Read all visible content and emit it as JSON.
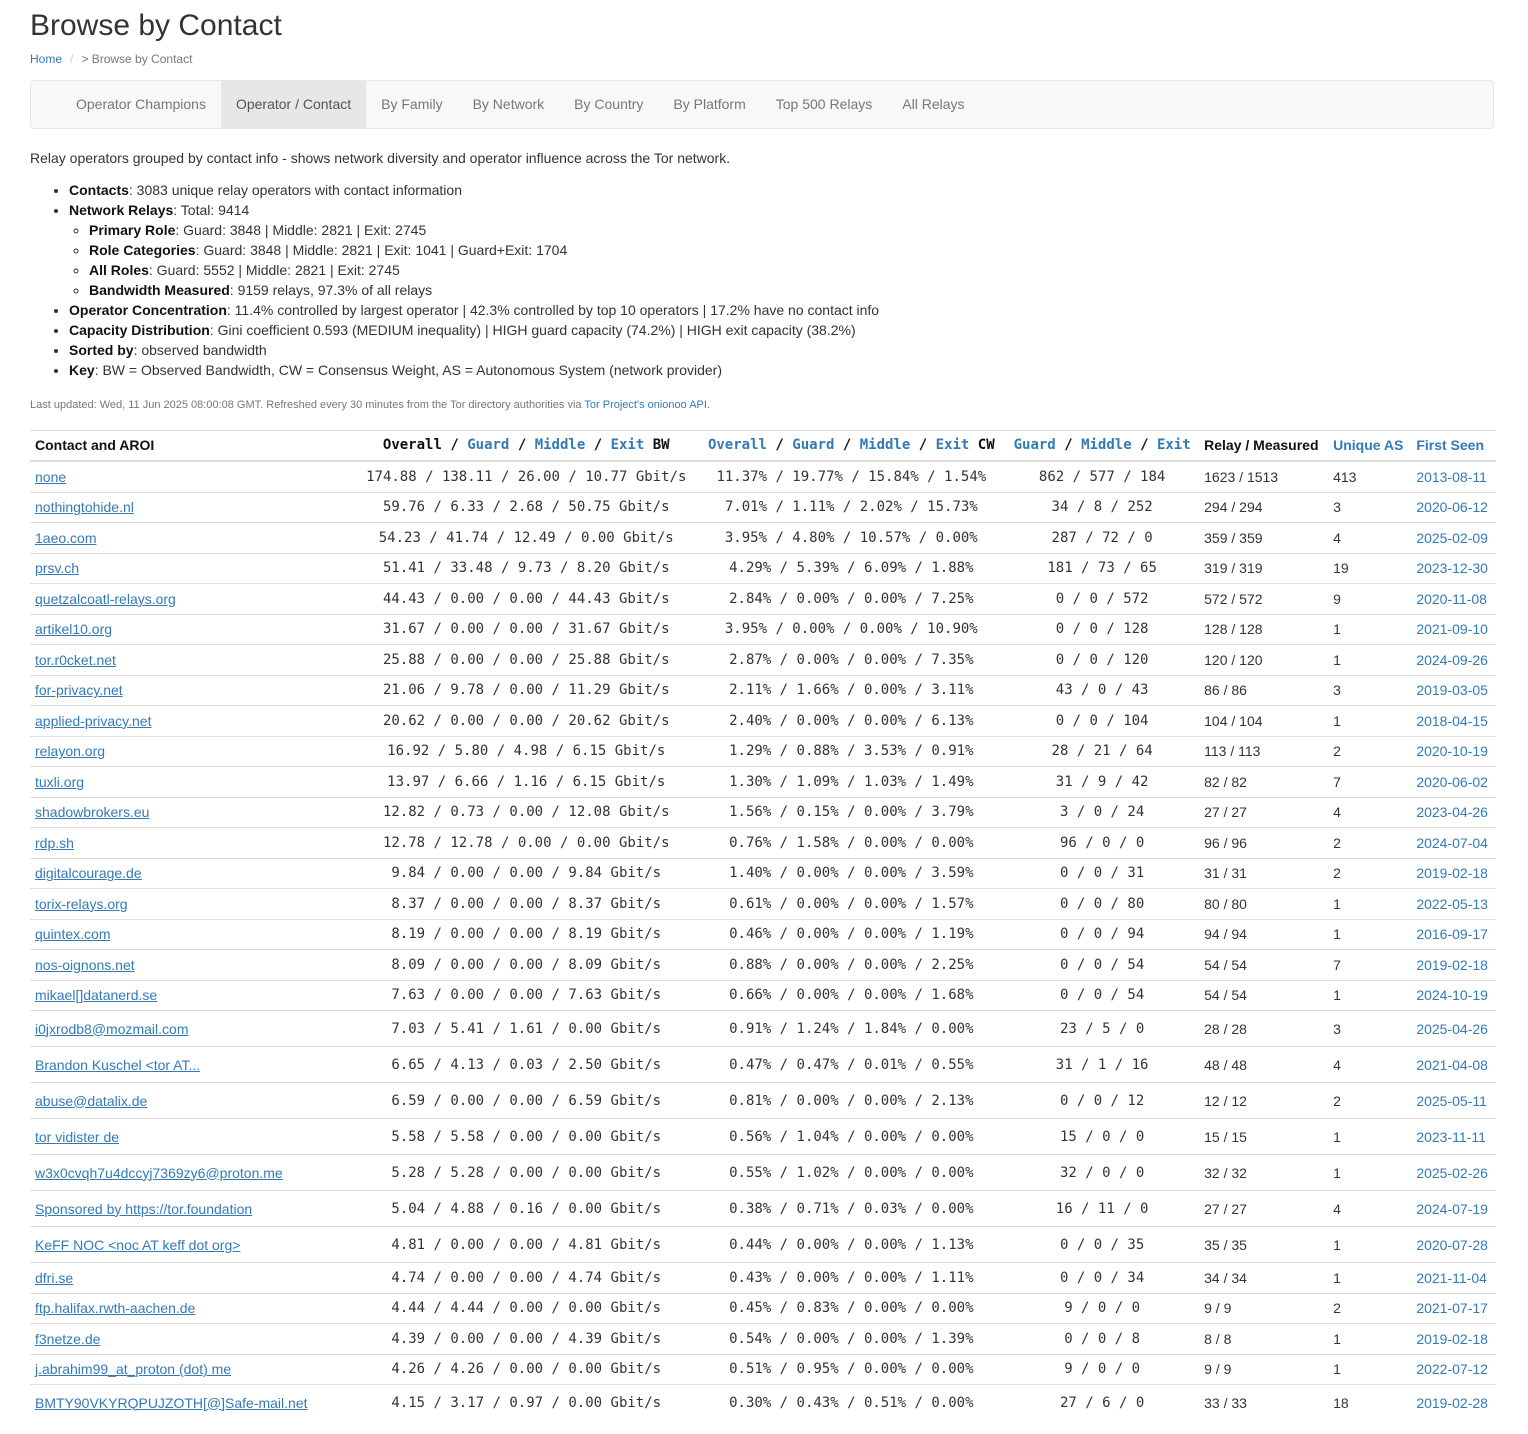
{
  "page": {
    "title": "Browse by Contact",
    "breadcrumb": {
      "home": "Home",
      "sep": "/",
      "current": "> Browse by Contact"
    }
  },
  "nav": {
    "tabs": [
      {
        "label": "Operator Champions"
      },
      {
        "label": "Operator / Contact"
      },
      {
        "label": "By Family"
      },
      {
        "label": "By Network"
      },
      {
        "label": "By Country"
      },
      {
        "label": "By Platform"
      },
      {
        "label": "Top 500 Relays"
      },
      {
        "label": "All Relays"
      }
    ]
  },
  "intro": "Relay operators grouped by contact info - shows network diversity and operator influence across the Tor network.",
  "summary": {
    "contacts": {
      "label": "Contacts",
      "text": ": 3083 unique relay operators with contact information"
    },
    "network_relays": {
      "label": "Network Relays",
      "text": ": Total: 9414"
    },
    "primary_role": {
      "label": "Primary Role",
      "text": ": Guard: 3848 | Middle: 2821 | Exit: 2745"
    },
    "role_categories": {
      "label": "Role Categories",
      "text": ": Guard: 3848 | Middle: 2821 | Exit: 1041 | Guard+Exit: 1704"
    },
    "all_roles": {
      "label": "All Roles",
      "text": ": Guard: 5552 | Middle: 2821 | Exit: 2745"
    },
    "bandwidth_measured": {
      "label": "Bandwidth Measured",
      "text": ": 9159 relays, 97.3% of all relays"
    },
    "operator_concentration": {
      "label": "Operator Concentration",
      "text": ": 11.4% controlled by largest operator | 42.3% controlled by top 10 operators | 17.2% have no contact info"
    },
    "capacity_distribution": {
      "label": "Capacity Distribution",
      "text": ": Gini coefficient 0.593 (MEDIUM inequality) | HIGH guard capacity (74.2%) | HIGH exit capacity (38.2%)"
    },
    "sorted_by": {
      "label": "Sorted by",
      "text": ": observed bandwidth"
    },
    "key": {
      "label": "Key",
      "text": ": BW = Observed Bandwidth, CW = Consensus Weight, AS = Autonomous System (network provider)"
    }
  },
  "updated": {
    "prefix": "Last updated: Wed, 11 Jun 2025 08:00:08 GMT. Refreshed every 30 minutes from the Tor directory authorities via ",
    "link": "Tor Project's onionoo API",
    "suffix": "."
  },
  "table": {
    "headers": {
      "contact": "Contact and AROI",
      "bw_overall": "Overall",
      "bw_guard": "Guard",
      "bw_middle": "Middle",
      "bw_exit": "Exit",
      "bw_suffix": "BW",
      "cw_overall": "Overall",
      "cw_guard": "Guard",
      "cw_middle": "Middle",
      "cw_exit": "Exit",
      "cw_suffix": "CW",
      "cnt_guard": "Guard",
      "cnt_middle": "Middle",
      "cnt_exit": "Exit",
      "relay_measured": "Relay / Measured",
      "unique_as": "Unique AS",
      "first_seen": "First Seen",
      "slash": "/"
    },
    "rows": [
      {
        "contact": "none",
        "bw": "174.88 / 138.11 / 26.00 / 10.77 Gbit/s",
        "cw": "11.37% / 19.77% / 15.84% / 1.54%",
        "counts": "862 / 577 / 184",
        "relays": "1623 / 1513",
        "as": "413",
        "seen": "2013-08-11"
      },
      {
        "contact": "nothingtohide.nl",
        "bw": "59.76 / 6.33 / 2.68 / 50.75 Gbit/s",
        "cw": "7.01% / 1.11% / 2.02% / 15.73%",
        "counts": "34 / 8 / 252",
        "relays": "294 / 294",
        "as": "3",
        "seen": "2020-06-12"
      },
      {
        "contact": "1aeo.com",
        "bw": "54.23 / 41.74 / 12.49 / 0.00 Gbit/s",
        "cw": "3.95% / 4.80% / 10.57% / 0.00%",
        "counts": "287 / 72 / 0",
        "relays": "359 / 359",
        "as": "4",
        "seen": "2025-02-09"
      },
      {
        "contact": "prsv.ch",
        "bw": "51.41 / 33.48 / 9.73 / 8.20 Gbit/s",
        "cw": "4.29% / 5.39% / 6.09% / 1.88%",
        "counts": "181 / 73 / 65",
        "relays": "319 / 319",
        "as": "19",
        "seen": "2023-12-30"
      },
      {
        "contact": "quetzalcoatl-relays.org",
        "bw": "44.43 / 0.00 / 0.00 / 44.43 Gbit/s",
        "cw": "2.84% / 0.00% / 0.00% / 7.25%",
        "counts": "0 / 0 / 572",
        "relays": "572 / 572",
        "as": "9",
        "seen": "2020-11-08"
      },
      {
        "contact": "artikel10.org",
        "bw": "31.67 / 0.00 / 0.00 / 31.67 Gbit/s",
        "cw": "3.95% / 0.00% / 0.00% / 10.90%",
        "counts": "0 / 0 / 128",
        "relays": "128 / 128",
        "as": "1",
        "seen": "2021-09-10"
      },
      {
        "contact": "tor.r0cket.net",
        "bw": "25.88 / 0.00 / 0.00 / 25.88 Gbit/s",
        "cw": "2.87% / 0.00% / 0.00% / 7.35%",
        "counts": "0 / 0 / 120",
        "relays": "120 / 120",
        "as": "1",
        "seen": "2024-09-26"
      },
      {
        "contact": "for-privacy.net",
        "bw": "21.06 / 9.78 / 0.00 / 11.29 Gbit/s",
        "cw": "2.11% / 1.66% / 0.00% / 3.11%",
        "counts": "43 / 0 / 43",
        "relays": "86 / 86",
        "as": "3",
        "seen": "2019-03-05"
      },
      {
        "contact": "applied-privacy.net",
        "bw": "20.62 / 0.00 / 0.00 / 20.62 Gbit/s",
        "cw": "2.40% / 0.00% / 0.00% / 6.13%",
        "counts": "0 / 0 / 104",
        "relays": "104 / 104",
        "as": "1",
        "seen": "2018-04-15"
      },
      {
        "contact": "relayon.org",
        "bw": "16.92 / 5.80 / 4.98 / 6.15 Gbit/s",
        "cw": "1.29% / 0.88% / 3.53% / 0.91%",
        "counts": "28 / 21 / 64",
        "relays": "113 / 113",
        "as": "2",
        "seen": "2020-10-19"
      },
      {
        "contact": "tuxli.org",
        "bw": "13.97 / 6.66 / 1.16 / 6.15 Gbit/s",
        "cw": "1.30% / 1.09% / 1.03% / 1.49%",
        "counts": "31 / 9 / 42",
        "relays": "82 / 82",
        "as": "7",
        "seen": "2020-06-02"
      },
      {
        "contact": "shadowbrokers.eu",
        "bw": "12.82 / 0.73 / 0.00 / 12.08 Gbit/s",
        "cw": "1.56% / 0.15% / 0.00% / 3.79%",
        "counts": "3 / 0 / 24",
        "relays": "27 / 27",
        "as": "4",
        "seen": "2023-04-26"
      },
      {
        "contact": "rdp.sh",
        "bw": "12.78 / 12.78 / 0.00 / 0.00 Gbit/s",
        "cw": "0.76% / 1.58% / 0.00% / 0.00%",
        "counts": "96 / 0 / 0",
        "relays": "96 / 96",
        "as": "2",
        "seen": "2024-07-04"
      },
      {
        "contact": "digitalcourage.de",
        "bw": "9.84 / 0.00 / 0.00 / 9.84 Gbit/s",
        "cw": "1.40% / 0.00% / 0.00% / 3.59%",
        "counts": "0 / 0 / 31",
        "relays": "31 / 31",
        "as": "2",
        "seen": "2019-02-18"
      },
      {
        "contact": "torix-relays.org",
        "bw": "8.37 / 0.00 / 0.00 / 8.37 Gbit/s",
        "cw": "0.61% / 0.00% / 0.00% / 1.57%",
        "counts": "0 / 0 / 80",
        "relays": "80 / 80",
        "as": "1",
        "seen": "2022-05-13"
      },
      {
        "contact": "quintex.com",
        "bw": "8.19 / 0.00 / 0.00 / 8.19 Gbit/s",
        "cw": "0.46% / 0.00% / 0.00% / 1.19%",
        "counts": "0 / 0 / 94",
        "relays": "94 / 94",
        "as": "1",
        "seen": "2016-09-17"
      },
      {
        "contact": "nos-oignons.net",
        "bw": "8.09 / 0.00 / 0.00 / 8.09 Gbit/s",
        "cw": "0.88% / 0.00% / 0.00% / 2.25%",
        "counts": "0 / 0 / 54",
        "relays": "54 / 54",
        "as": "7",
        "seen": "2019-02-18"
      },
      {
        "contact": "mikael[]datanerd.se",
        "bw": "7.63 / 0.00 / 0.00 / 7.63 Gbit/s",
        "cw": "0.66% / 0.00% / 0.00% / 1.68%",
        "counts": "0 / 0 / 54",
        "relays": "54 / 54",
        "as": "1",
        "seen": "2024-10-19"
      },
      {
        "contact": "i0jxrodb8@mozmail.com",
        "bw": "7.03 / 5.41 / 1.61 / 0.00 Gbit/s",
        "cw": "0.91% / 1.24% / 1.84% / 0.00%",
        "counts": "23 / 5 / 0",
        "relays": "28 / 28",
        "as": "3",
        "seen": "2025-04-26",
        "tall": true
      },
      {
        "contact": "Brandon Kuschel <tor AT...",
        "bw": "6.65 / 4.13 / 0.03 / 2.50 Gbit/s",
        "cw": "0.47% / 0.47% / 0.01% / 0.55%",
        "counts": "31 / 1 / 16",
        "relays": "48 / 48",
        "as": "4",
        "seen": "2021-04-08",
        "tall": true
      },
      {
        "contact": "abuse@datalix.de",
        "bw": "6.59 / 0.00 / 0.00 / 6.59 Gbit/s",
        "cw": "0.81% / 0.00% / 0.00% / 2.13%",
        "counts": "0 / 0 / 12",
        "relays": "12 / 12",
        "as": "2",
        "seen": "2025-05-11",
        "tall": true
      },
      {
        "contact": "tor vidister de",
        "bw": "5.58 / 5.58 / 0.00 / 0.00 Gbit/s",
        "cw": "0.56% / 1.04% / 0.00% / 0.00%",
        "counts": "15 / 0 / 0",
        "relays": "15 / 15",
        "as": "1",
        "seen": "2023-11-11",
        "tall": true
      },
      {
        "contact": "w3x0cvqh7u4dccyj7369zy6@proton.me",
        "bw": "5.28 / 5.28 / 0.00 / 0.00 Gbit/s",
        "cw": "0.55% / 1.02% / 0.00% / 0.00%",
        "counts": "32 / 0 / 0",
        "relays": "32 / 32",
        "as": "1",
        "seen": "2025-02-26",
        "tall": true
      },
      {
        "contact": "Sponsored by https://tor.foundation",
        "bw": "5.04 / 4.88 / 0.16 / 0.00 Gbit/s",
        "cw": "0.38% / 0.71% / 0.03% / 0.00%",
        "counts": "16 / 11 / 0",
        "relays": "27 / 27",
        "as": "4",
        "seen": "2024-07-19",
        "tall": true
      },
      {
        "contact": "KeFF NOC <noc AT keff dot org>",
        "bw": "4.81 / 0.00 / 0.00 / 4.81 Gbit/s",
        "cw": "0.44% / 0.00% / 0.00% / 1.13%",
        "counts": "0 / 0 / 35",
        "relays": "35 / 35",
        "as": "1",
        "seen": "2020-07-28",
        "tall": true
      },
      {
        "contact": "dfri.se",
        "bw": "4.74 / 0.00 / 0.00 / 4.74 Gbit/s",
        "cw": "0.43% / 0.00% / 0.00% / 1.11%",
        "counts": "0 / 0 / 34",
        "relays": "34 / 34",
        "as": "1",
        "seen": "2021-11-04"
      },
      {
        "contact": "ftp.halifax.rwth-aachen.de",
        "bw": "4.44 / 4.44 / 0.00 / 0.00 Gbit/s",
        "cw": "0.45% / 0.83% / 0.00% / 0.00%",
        "counts": "9 / 0 / 0",
        "relays": "9 / 9",
        "as": "2",
        "seen": "2021-07-17"
      },
      {
        "contact": "f3netze.de",
        "bw": "4.39 / 0.00 / 0.00 / 4.39 Gbit/s",
        "cw": "0.54% / 0.00% / 0.00% / 1.39%",
        "counts": "0 / 0 / 8",
        "relays": "8 / 8",
        "as": "1",
        "seen": "2019-02-18"
      },
      {
        "contact": "j.abrahim99_at_proton (dot) me",
        "bw": "4.26 / 4.26 / 0.00 / 0.00 Gbit/s",
        "cw": "0.51% / 0.95% / 0.00% / 0.00%",
        "counts": "9 / 0 / 0",
        "relays": "9 / 9",
        "as": "1",
        "seen": "2022-07-12"
      },
      {
        "contact": "BMTY90VKYRQPUJZOTH[@]Safe-mail.net",
        "bw": "4.15 / 3.17 / 0.97 / 0.00 Gbit/s",
        "cw": "0.30% / 0.43% / 0.51% / 0.00%",
        "counts": "27 / 6 / 0",
        "relays": "33 / 33",
        "as": "18",
        "seen": "2019-02-28",
        "tall": true
      }
    ]
  }
}
